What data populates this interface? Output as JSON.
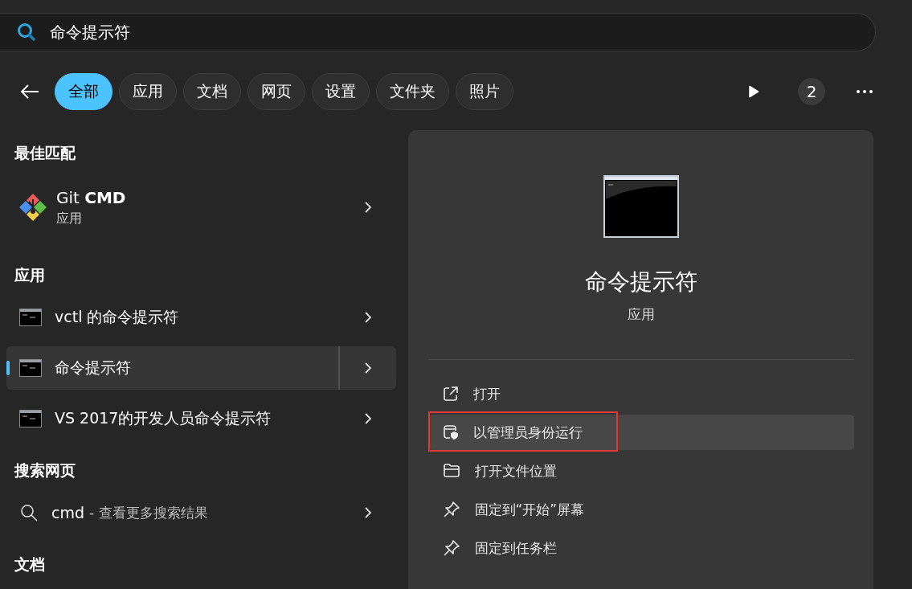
{
  "search": {
    "value": "命令提示符"
  },
  "filters": [
    {
      "label": "全部",
      "selected": true
    },
    {
      "label": "应用",
      "selected": false
    },
    {
      "label": "文档",
      "selected": false
    },
    {
      "label": "网页",
      "selected": false
    },
    {
      "label": "设置",
      "selected": false
    },
    {
      "label": "文件夹",
      "selected": false
    },
    {
      "label": "照片",
      "selected": false
    }
  ],
  "badge": "2",
  "best_match": {
    "heading": "最佳匹配",
    "title": "Git **CMD**",
    "subtitle": "应用"
  },
  "apps": {
    "heading": "应用",
    "items": [
      {
        "label": "vctl 的命令提示符",
        "selected": false
      },
      {
        "label": "命令提示符",
        "selected": true
      },
      {
        "label": "VS 2017的开发人员命令提示符",
        "selected": false
      }
    ]
  },
  "web": {
    "heading": "搜索网页",
    "query": "cmd",
    "hint": "- 查看更多搜索结果"
  },
  "documents": {
    "heading": "文档"
  },
  "detail": {
    "title": "命令提示符",
    "subtitle": "应用",
    "actions": [
      {
        "kind": "open",
        "label": "打开",
        "highlighted": false,
        "outlined": false
      },
      {
        "kind": "admin",
        "label": "以管理员身份运行",
        "highlighted": true,
        "outlined": true
      },
      {
        "kind": "folder",
        "label": "打开文件位置",
        "highlighted": false,
        "outlined": false
      },
      {
        "kind": "pin",
        "label": "固定到“开始”屏幕",
        "highlighted": false,
        "outlined": false
      },
      {
        "kind": "pin",
        "label": "固定到任务栏",
        "highlighted": false,
        "outlined": false
      }
    ]
  }
}
